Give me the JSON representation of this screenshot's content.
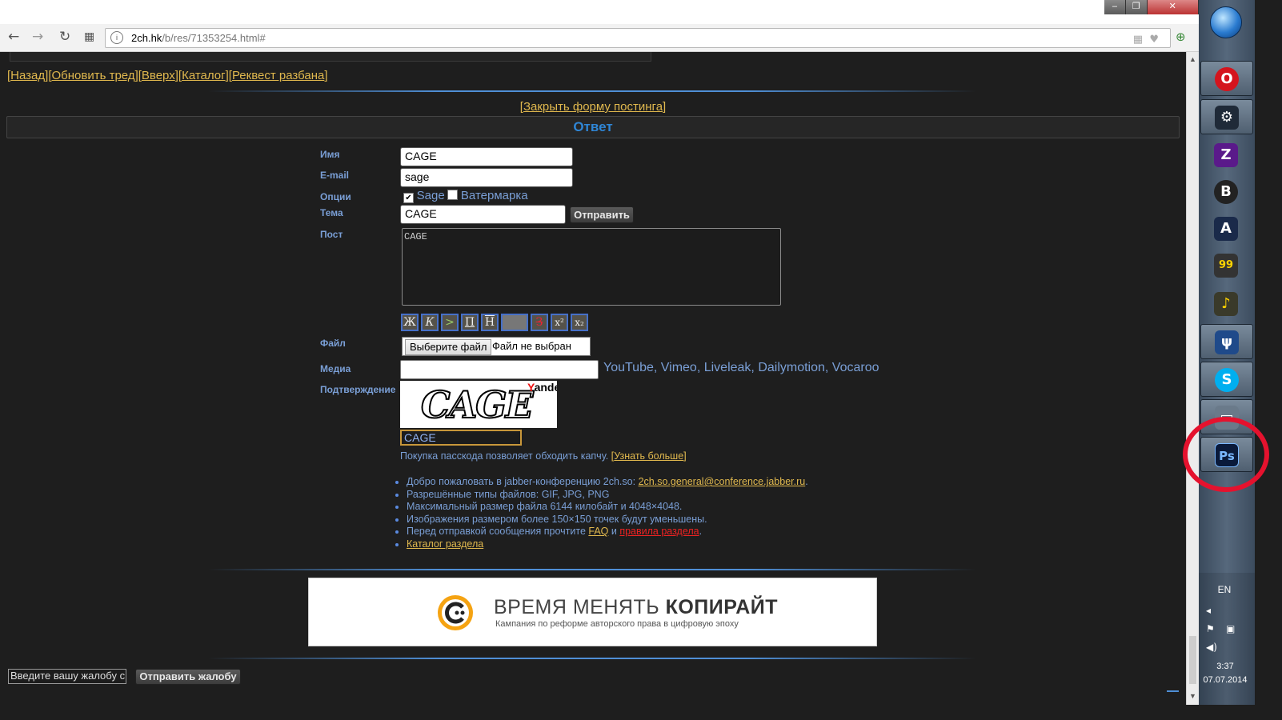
{
  "browser": {
    "url_host": "2ch.hk",
    "url_path": "/b/res/71353254.html#",
    "window_controls": [
      "–",
      "❐",
      "✕"
    ]
  },
  "nav": {
    "links": [
      "Назад",
      "Обновить тред",
      "Вверх",
      "Каталог",
      "Реквест разбана"
    ],
    "close_form": "Закрыть форму постинга"
  },
  "form": {
    "title": "Ответ",
    "name_label": "Имя",
    "name_value": "CAGE",
    "email_label": "E-mail",
    "email_value": "sage",
    "options_label": "Опции",
    "opt_sage": "Sage",
    "opt_sage_checked": true,
    "opt_watermark": "Ватермарка",
    "opt_watermark_checked": false,
    "subject_label": "Тема",
    "subject_value": "CAGE",
    "submit_label": "Отправить",
    "post_label": "Пост",
    "post_value": "CAGE",
    "markup_buttons": [
      "Ж",
      "К",
      ">",
      "П",
      "Н",
      "",
      "З",
      "x²",
      "x₂"
    ],
    "file_label": "Файл",
    "file_choose": "Выберите файл",
    "file_none": "Файл не выбран",
    "media_label": "Медиа",
    "media_value": "",
    "media_hint": "YouTube, Vimeo, Liveleak, Dailymotion, Vocaroo",
    "captcha_label": "Подтверждение",
    "captcha_image_text": "CAGE",
    "captcha_provider_y": "Y",
    "captcha_provider_rest": "andex",
    "captcha_value": "CAGE",
    "passcode_text": "Покупка пасскода позволяет обходить капчу. ",
    "passcode_link": "Узнать больше"
  },
  "rules": {
    "r1_text": "Добро пожаловать в jabber-конференцию 2ch.so: ",
    "r1_link": "2ch.so.general@conference.jabber.ru",
    "r2": "Разрешённые типы файлов: GIF, JPG, PNG",
    "r3": "Максимальный размер файла 6144 килобайт и 4048×4048.",
    "r4": "Изображения размером более 150×150 точек будут уменьшены.",
    "r5_text": "Перед отправкой сообщения прочтите ",
    "r5_faq": "FAQ",
    "r5_and": " и ",
    "r5_rules": "правила раздела",
    "r6_link": "Каталог раздела"
  },
  "banner": {
    "title_light": "ВРЕМЯ МЕНЯТЬ ",
    "title_bold": "КОПИРАЙТ",
    "subtitle": "Кампания по реформе авторского права в цифровую эпоху"
  },
  "complaint": {
    "placeholder": "Введите вашу жалобу сюда",
    "button": "Отправить жалобу"
  },
  "taskbar": {
    "apps": [
      {
        "icon": "opera-icon",
        "glyph": "O",
        "color": "#d4141d"
      },
      {
        "icon": "steam-icon",
        "glyph": "⚙",
        "color": "#1f2a38"
      },
      {
        "icon": "z-app-icon",
        "glyph": "Z",
        "color": "#5a1a8a"
      },
      {
        "icon": "ble-app-icon",
        "glyph": "B",
        "color": "#222222"
      },
      {
        "icon": "ad-app-icon",
        "glyph": "A",
        "color": "#1a2a4a"
      },
      {
        "icon": "99-app-icon",
        "glyph": "99",
        "color": "#333333"
      },
      {
        "icon": "music-app-icon",
        "glyph": "♪",
        "color": "#3a3a2a"
      },
      {
        "icon": "psi-app-icon",
        "glyph": "ψ",
        "color": "#1f4a8a"
      },
      {
        "icon": "skype-icon",
        "glyph": "S",
        "color": "#00aff0"
      },
      {
        "icon": "window-app-icon",
        "glyph": "▭",
        "color": "#6a7a8a"
      },
      {
        "icon": "photoshop-icon",
        "glyph": "Ps",
        "color": "#0a1a3a"
      }
    ],
    "lang": "EN",
    "time": "3:37",
    "date": "07.07.2014"
  }
}
